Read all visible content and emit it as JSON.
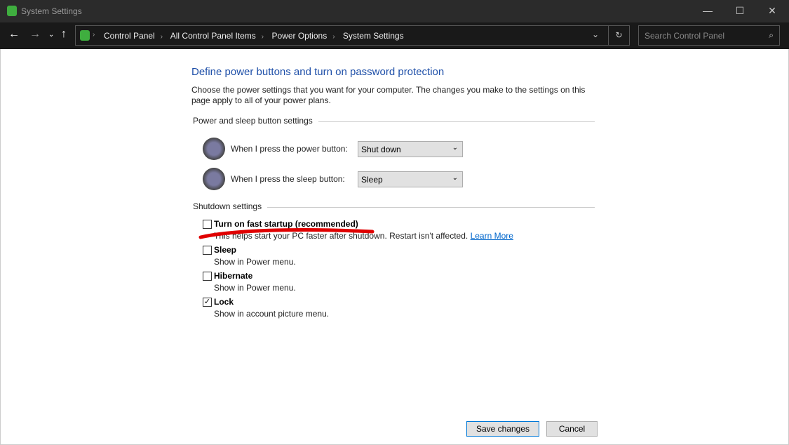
{
  "window": {
    "title": "System Settings",
    "minimize": "—",
    "maximize": "☐",
    "close": "✕"
  },
  "nav": {
    "breadcrumb": [
      "Control Panel",
      "All Control Panel Items",
      "Power Options",
      "System Settings"
    ],
    "search_placeholder": "Search Control Panel"
  },
  "page": {
    "title": "Define power buttons and turn on password protection",
    "intro": "Choose the power settings that you want for your computer. The changes you make to the settings on this page apply to all of your power plans.",
    "power_group": "Power and sleep button settings",
    "power_label": "When I press the power button:",
    "power_value": "Shut down",
    "sleep_label": "When I press the sleep button:",
    "sleep_value": "Sleep",
    "shutdown_group": "Shutdown settings",
    "options": [
      {
        "label": "Turn on fast startup (recommended)",
        "desc": "This helps start your PC faster after shutdown. Restart isn't affected.",
        "link": "Learn More",
        "checked": false
      },
      {
        "label": "Sleep",
        "desc": "Show in Power menu.",
        "checked": false
      },
      {
        "label": "Hibernate",
        "desc": "Show in Power menu.",
        "checked": false
      },
      {
        "label": "Lock",
        "desc": "Show in account picture menu.",
        "checked": true
      }
    ],
    "save": "Save changes",
    "cancel": "Cancel"
  },
  "colors": {
    "accent": "#0078d7",
    "title": "#1e4fa8",
    "annotation": "#e00000"
  }
}
